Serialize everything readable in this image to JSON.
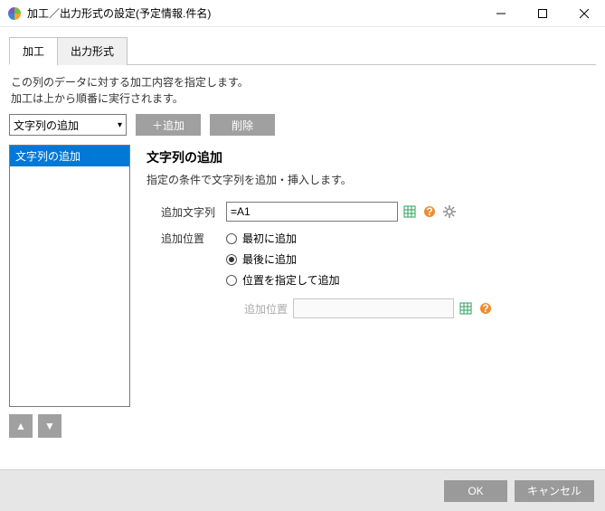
{
  "window": {
    "title": "加工／出力形式の設定(予定情報.件名)"
  },
  "tabs": {
    "tab0": "加工",
    "tab1": "出力形式"
  },
  "description": {
    "line1": "この列のデータに対する加工内容を指定します。",
    "line2": "加工は上から順番に実行されます。"
  },
  "toolbar": {
    "combo_selected": "文字列の追加",
    "add": "＋追加",
    "delete": "削除"
  },
  "list": {
    "items": [
      "文字列の追加"
    ]
  },
  "detail": {
    "heading": "文字列の追加",
    "sub": "指定の条件で文字列を追加・挿入します。",
    "add_string_label": "追加文字列",
    "add_string_value": "=A1",
    "add_pos_label": "追加位置",
    "radios": {
      "r0": "最初に追加",
      "r1": "最後に追加",
      "r2": "位置を指定して追加"
    },
    "pos_label": "追加位置",
    "pos_value": ""
  },
  "footer": {
    "ok": "OK",
    "cancel": "キャンセル"
  }
}
